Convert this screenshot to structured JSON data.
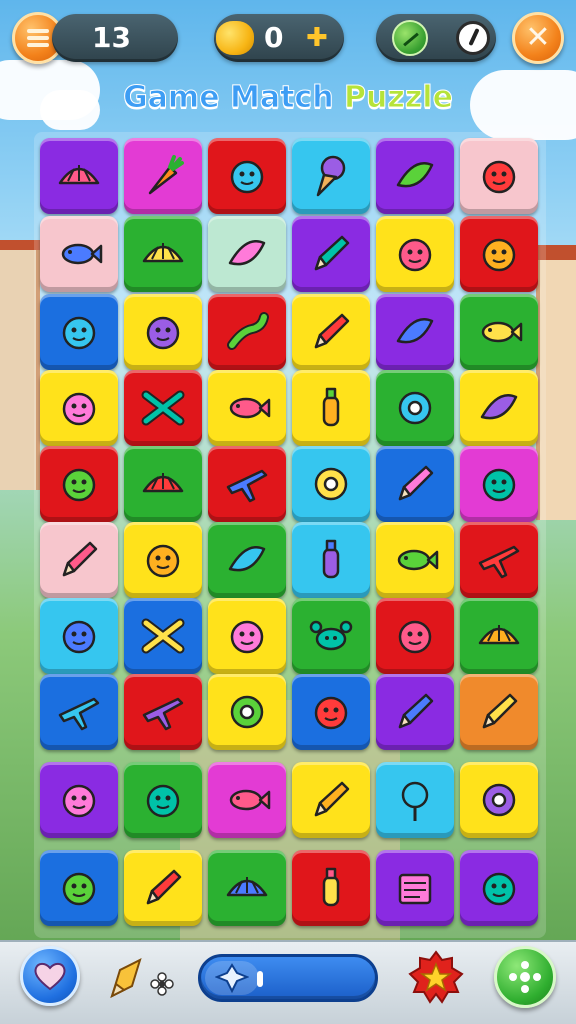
{
  "hud": {
    "moves": "13",
    "coins": "0",
    "menu_icon": "menu-icon",
    "close_icon": "close-icon"
  },
  "title": {
    "part1": "Game Match ",
    "part2": "Puzzle"
  },
  "colors": {
    "purple": "#8a2be2",
    "magenta": "#e33bd4",
    "red": "#e0161b",
    "cyan": "#36c6ef",
    "pink": "#f7c6cd",
    "green": "#2bb131",
    "mint": "#bde8d2",
    "yellow": "#ffe21b",
    "blue": "#1b6fe0",
    "orange": "#f08a2c"
  },
  "board": {
    "rows": [
      [
        {
          "c": "purple",
          "i": "shell-icon"
        },
        {
          "c": "magenta",
          "i": "carrot-icon"
        },
        {
          "c": "red",
          "i": "ball-icon"
        },
        {
          "c": "cyan",
          "i": "icecream-icon"
        },
        {
          "c": "purple",
          "i": "banana-icon"
        },
        {
          "c": "pink",
          "i": "frog-icon"
        }
      ],
      [
        {
          "c": "pink",
          "i": "fish-blue-icon"
        },
        {
          "c": "green",
          "i": "shell-orange-icon"
        },
        {
          "c": "mint",
          "i": "sausage-icon"
        },
        {
          "c": "purple",
          "i": "pencil-icon"
        },
        {
          "c": "yellow",
          "i": "pig-icon"
        },
        {
          "c": "red",
          "i": "pig-face-icon"
        }
      ],
      [
        {
          "c": "blue",
          "i": "blob-pink-icon"
        },
        {
          "c": "yellow",
          "i": "strawberry-icon"
        },
        {
          "c": "red",
          "i": "lizard-icon"
        },
        {
          "c": "yellow",
          "i": "brush-icon"
        },
        {
          "c": "purple",
          "i": "banana-icon"
        },
        {
          "c": "green",
          "i": "donut-fish-icon"
        }
      ],
      [
        {
          "c": "yellow",
          "i": "tomato-icon"
        },
        {
          "c": "red",
          "i": "bow-icon"
        },
        {
          "c": "yellow",
          "i": "fish-cyan-icon"
        },
        {
          "c": "yellow",
          "i": "hairdryer-icon"
        },
        {
          "c": "green",
          "i": "planet-icon"
        },
        {
          "c": "yellow",
          "i": "surfboard-icon"
        }
      ],
      [
        {
          "c": "red",
          "i": "cat-face-icon"
        },
        {
          "c": "green",
          "i": "taco-icon"
        },
        {
          "c": "red",
          "i": "airplane-icon"
        },
        {
          "c": "cyan",
          "i": "donut-red-icon"
        },
        {
          "c": "blue",
          "i": "pen-star-icon"
        },
        {
          "c": "magenta",
          "i": "blob-blue-icon"
        }
      ],
      [
        {
          "c": "pink",
          "i": "crayon-icon"
        },
        {
          "c": "yellow",
          "i": "bird-icon"
        },
        {
          "c": "green",
          "i": "hotdog-icon"
        },
        {
          "c": "cyan",
          "i": "bottle-icon"
        },
        {
          "c": "yellow",
          "i": "fish-blue-icon"
        },
        {
          "c": "red",
          "i": "trumpet-icon"
        }
      ],
      [
        {
          "c": "cyan",
          "i": "blob-red-icon"
        },
        {
          "c": "blue",
          "i": "cross-icon"
        },
        {
          "c": "yellow",
          "i": "tomato-icon"
        },
        {
          "c": "green",
          "i": "crab-icon"
        },
        {
          "c": "red",
          "i": "cat-face-icon"
        },
        {
          "c": "green",
          "i": "croissant-icon"
        }
      ],
      [
        {
          "c": "blue",
          "i": "plane-yellow-icon"
        },
        {
          "c": "red",
          "i": "plane-blue-icon"
        },
        {
          "c": "yellow",
          "i": "donut-magenta-icon"
        },
        {
          "c": "blue",
          "i": "chick-red-icon"
        },
        {
          "c": "purple",
          "i": "pen-blue-icon"
        },
        {
          "c": "orange",
          "i": "crayon-box-icon"
        }
      ],
      [
        {
          "c": "purple",
          "i": "bird-blue-icon"
        },
        {
          "c": "green",
          "i": "ball-yellow-icon"
        },
        {
          "c": "magenta",
          "i": "fish-cyan-icon"
        },
        {
          "c": "yellow",
          "i": "brush-icon"
        },
        {
          "c": "cyan",
          "i": "pushpin-icon"
        },
        {
          "c": "yellow",
          "i": "ring-icon"
        }
      ],
      [
        {
          "c": "blue",
          "i": "bird-orange-icon"
        },
        {
          "c": "yellow",
          "i": "pen-purple-icon"
        },
        {
          "c": "green",
          "i": "croissant-icon"
        },
        {
          "c": "red",
          "i": "bottle-cyan-icon"
        },
        {
          "c": "purple",
          "i": "notepad-icon"
        },
        {
          "c": "purple",
          "i": "teddy-icon"
        }
      ]
    ]
  },
  "bottom": {
    "heart_icon": "heart-icon",
    "pencil_icon": "pencil-icon",
    "progress_fill": 0.32,
    "star_icon": "star-icon",
    "dice_icon": "dice-icon"
  }
}
